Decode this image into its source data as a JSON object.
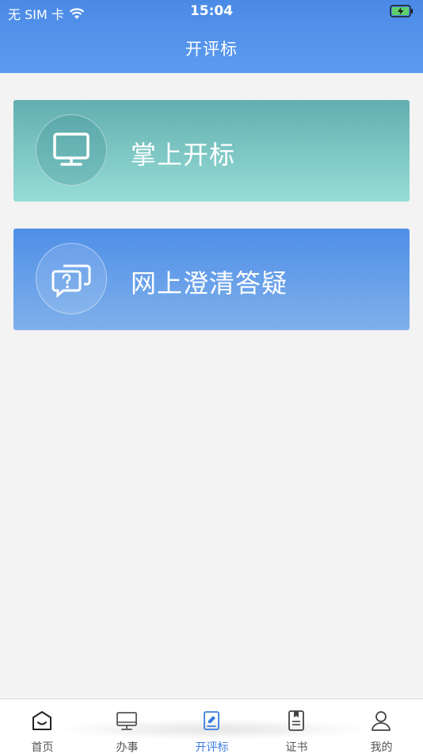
{
  "status_bar": {
    "carrier": "无 SIM 卡",
    "time": "15:04",
    "wifi_icon": "wifi-icon",
    "battery_icon": "battery-charging-icon"
  },
  "nav": {
    "title": "开评标"
  },
  "cards": [
    {
      "label": "掌上开标",
      "icon": "monitor-icon"
    },
    {
      "label": "网上澄清答疑",
      "icon": "question-chat-icon"
    }
  ],
  "tabs": [
    {
      "label": "首页",
      "icon": "home-icon",
      "active": false
    },
    {
      "label": "办事",
      "icon": "monitor-icon",
      "active": false
    },
    {
      "label": "开评标",
      "icon": "edit-doc-icon",
      "active": true
    },
    {
      "label": "证书",
      "icon": "certificate-icon",
      "active": false
    },
    {
      "label": "我的",
      "icon": "user-icon",
      "active": false
    }
  ],
  "colors": {
    "header": "#4a8ae6",
    "card_teal": "#62aeb0",
    "card_blue": "#4f8fe8",
    "tab_active": "#3b7de0"
  }
}
